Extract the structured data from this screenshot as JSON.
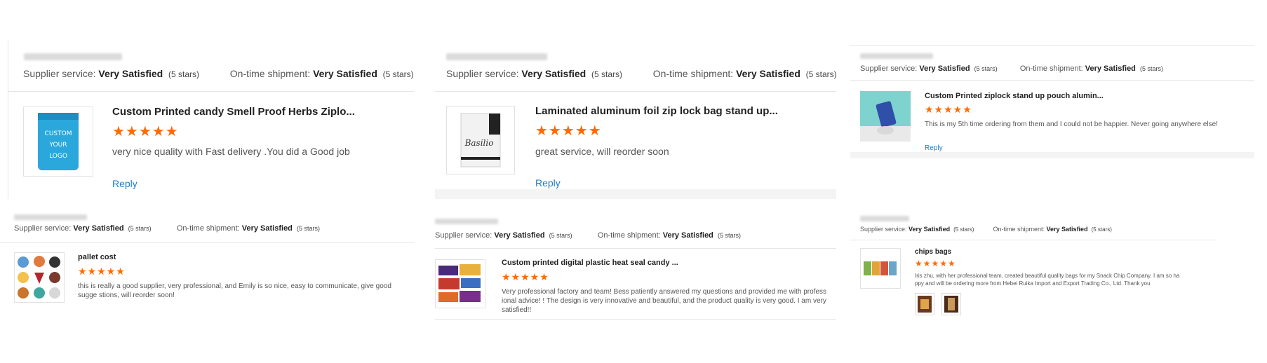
{
  "labels": {
    "supplier": "Supplier service:",
    "shipment": "On-time shipment:",
    "rating": "Very Satisfied",
    "stars_text": "(5 stars)",
    "reply": "Reply",
    "stars": "★★★★★"
  },
  "reviews": [
    {
      "title": "Custom Printed candy Smell Proof Herbs Ziplo...",
      "text": "very nice quality with Fast delivery .You did a Good job",
      "thumb_text": "CUSTOM YOUR LOGO"
    },
    {
      "title": "Laminated aluminum foil zip lock bag stand up...",
      "text": "great service, will reorder soon",
      "thumb_text": "Basilio"
    },
    {
      "title": "Custom Printed ziplock stand up pouch alumin...",
      "text": "This is my 5th time ordering from them and I could not be happier. Never going anywhere else!"
    },
    {
      "title": "pallet cost",
      "text": "this is really a good supplier, very professional, and Emily is so nice, easy to communicate, give good sugge stions, will reorder soon!"
    },
    {
      "title": "Custom printed digital plastic heat seal candy ...",
      "text": "Very professional factory and team!   Bess patiently answered my questions and provided me with profess ional advice!  !  The design is very innovative and beautiful, and the product quality is very good. I am very satisfied!!"
    },
    {
      "title": "chips bags",
      "text": "Iris zhu, with her professional team, created beautiful quality bags for my Snack Chip Company. I am so ha ppy and will be ordering more from Hebei Ruika Import and Export Trading Co., Ltd.  Thank you"
    }
  ],
  "colors": {
    "star": "#ff6a00",
    "reply": "#1e7dc7"
  }
}
